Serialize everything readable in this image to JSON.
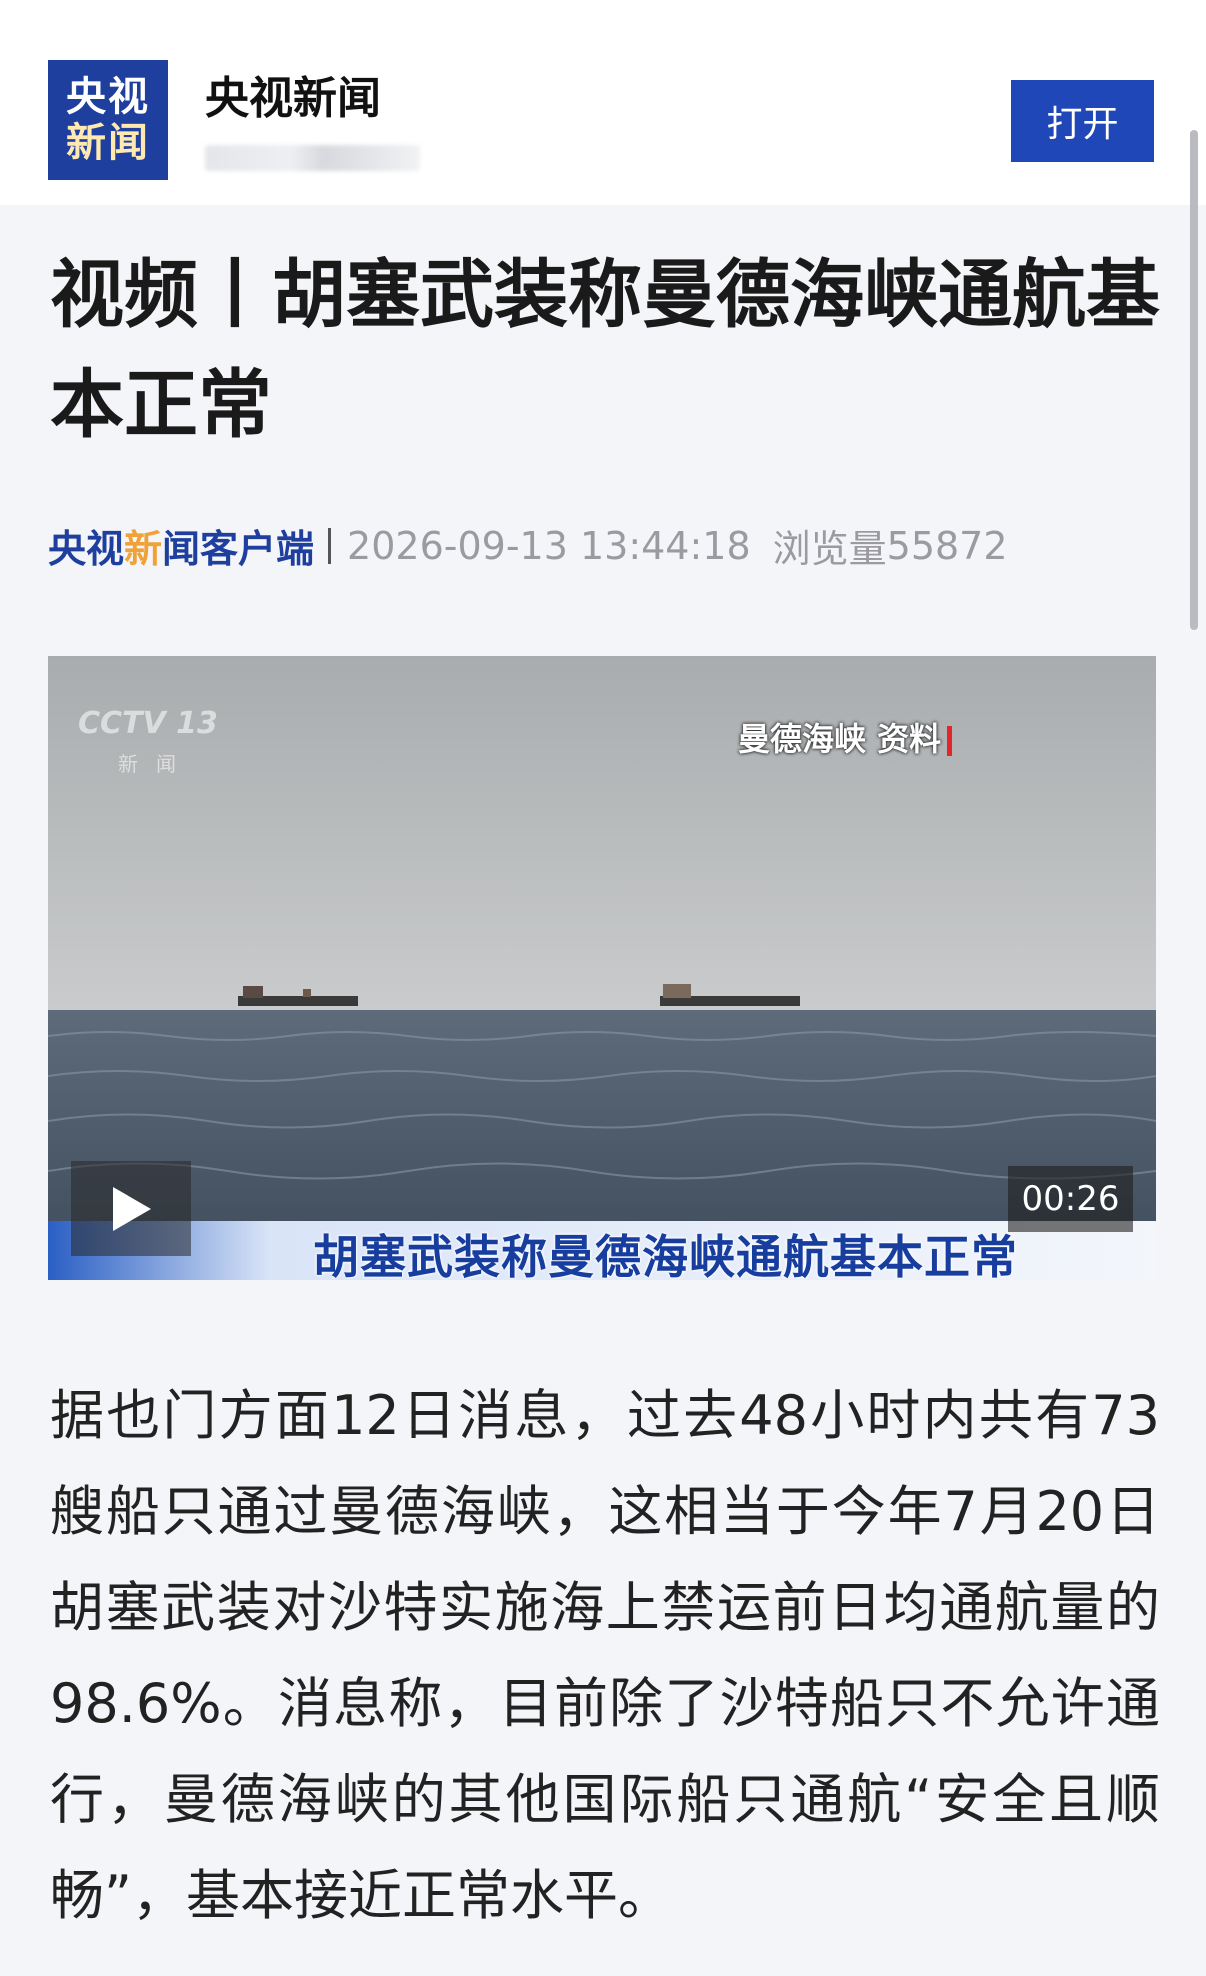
{
  "header": {
    "logo_line1": "央视",
    "logo_line2": "新闻",
    "app_name": "央视新闻",
    "open_button": "打开"
  },
  "article": {
    "title": "视频丨胡塞武装称曼德海峡通航基本正常",
    "source_part1": "央视",
    "source_part2": "新",
    "source_part3": "闻客户端",
    "date": "2026-09-13 13:44:18",
    "views_label": "浏览量",
    "views_count": "55872",
    "body": "据也门方面12日消息，过去48小时内共有73艘船只通过曼德海峡，这相当于今年7月20日胡塞武装对沙特实施海上禁运前日均通航量的98.6%。消息称，目前除了沙特船只不允许通行，曼德海峡的其他国际船只通航“安全且顺畅”，基本接近正常水平。"
  },
  "video": {
    "channel_logo": "CCTV 13",
    "channel_sub": "新闻",
    "location_caption": "曼德海峡 资料",
    "headline": "胡塞武装称曼德海峡通航基本正常",
    "duration": "00:26",
    "play_icon": "play-icon"
  },
  "colors": {
    "brand_blue": "#1f3f9e",
    "button_blue": "#1f47b8",
    "accent_orange": "#f0a23a",
    "meta_gray": "#9a9aa0"
  }
}
